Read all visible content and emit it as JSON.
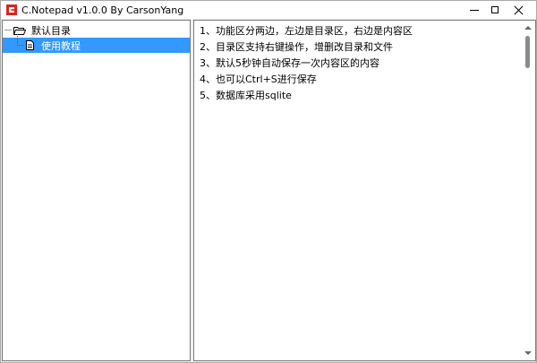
{
  "window": {
    "title": "C.Notepad v1.0.0 By CarsonYang"
  },
  "tree": {
    "root": {
      "label": "默认目录",
      "icon": "folder-open-icon"
    },
    "children": [
      {
        "label": "使用教程",
        "icon": "document-icon",
        "selected": true
      }
    ]
  },
  "content": {
    "lines": [
      "1、功能区分两边，左边是目录区，右边是内容区",
      "2、目录区支持右键操作，增删改目录和文件",
      "3、默认5秒钟自动保存一次内容区的内容",
      "4、也可以Ctrl+S进行保存",
      "5、数据库采用sqlite"
    ]
  },
  "colors": {
    "selection": "#3399ff",
    "app_icon": "#d9261c"
  }
}
